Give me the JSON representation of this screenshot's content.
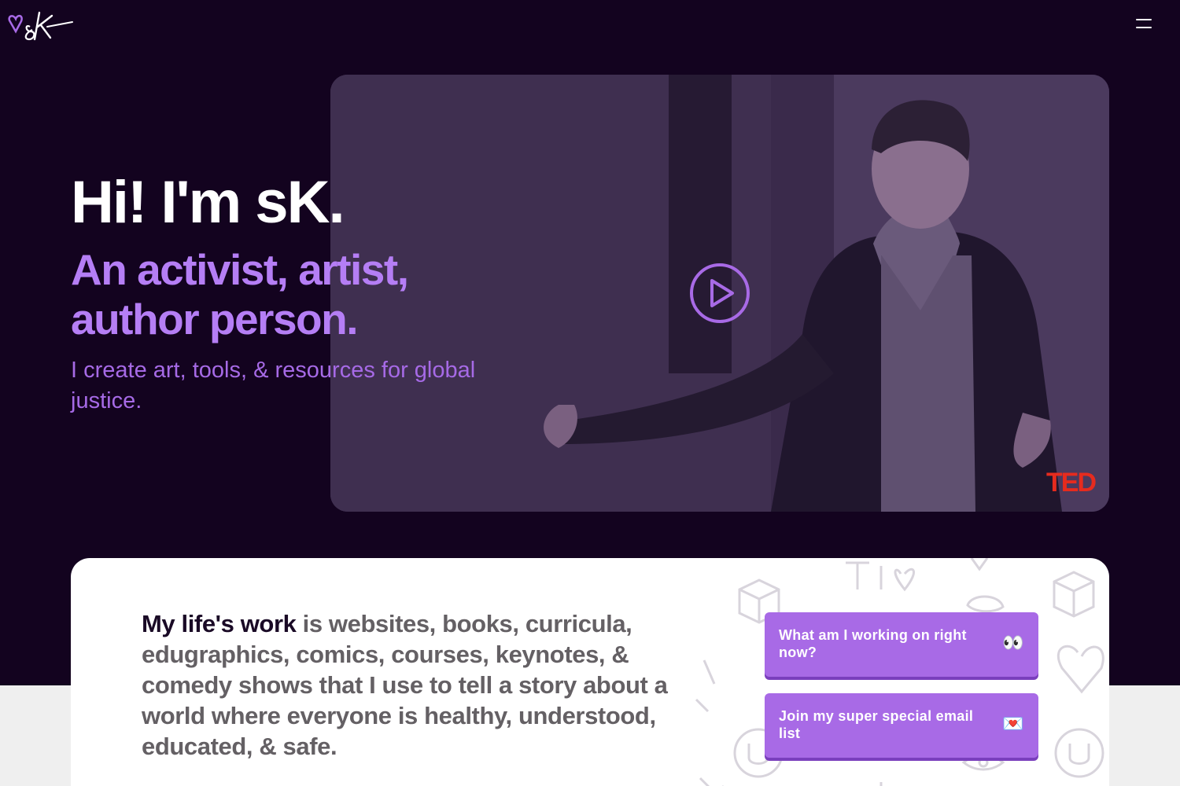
{
  "header": {
    "logo_icon": "sk-signature-logo-icon",
    "menu_icon": "hamburger-menu-icon"
  },
  "hero": {
    "title": "Hi! I'm sK.",
    "subtitle": "An activist, artist, author person.",
    "tagline": "I create art, tools, & resources for global justice."
  },
  "video": {
    "play_icon": "play-circle-icon",
    "badge": "TED"
  },
  "intro": {
    "lead": "My life's work",
    "body": " is websites, books, curricula, edugraphics, comics, courses, keynotes, & comedy shows that I use to tell a story about a world where everyone is healthy, understood, educated, & safe."
  },
  "cta": [
    {
      "label": "What am I working on right now?",
      "emoji": "👀"
    },
    {
      "label": "Join my super special email list",
      "emoji": "💌"
    }
  ],
  "colors": {
    "hero_bg": "#13031f",
    "accent_purple": "#b57ef5",
    "button_purple": "#a86ae6",
    "ted_red": "#e62b1e"
  }
}
